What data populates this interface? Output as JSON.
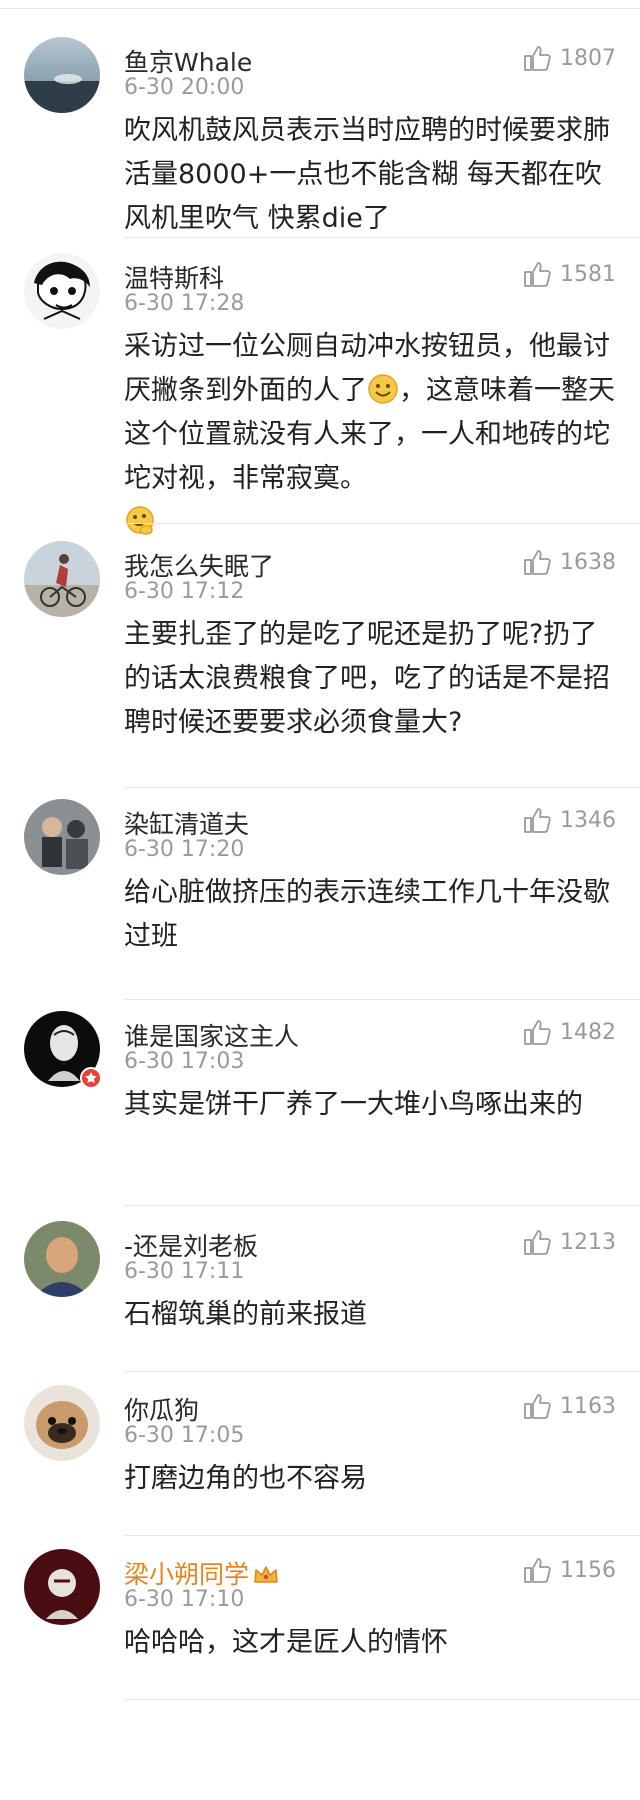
{
  "comments": [
    {
      "name": "鱼京Whale",
      "time": "6-30 20:00",
      "likes": "1807",
      "text": "吹风机鼓风员表示当时应聘的时候要求肺活量8000+一点也不能含糊 每天都在吹风机里吹气 快累die了"
    },
    {
      "name": "温特斯科",
      "time": "6-30 17:28",
      "likes": "1581",
      "text_a": "采访过一位公厕自动冲水按钮员，他最讨厌撇条到外面的人了",
      "text_b": "，这意味着一整天这个位置就没有人来了，一人和地砖的坨坨对视，非常寂寞。"
    },
    {
      "name": "我怎么失眠了",
      "time": "6-30 17:12",
      "likes": "1638",
      "text": "主要扎歪了的是吃了呢还是扔了呢?扔了的话太浪费粮食了吧，吃了的话是不是招聘时候还要要求必须食量大?"
    },
    {
      "name": "染缸清道夫",
      "time": "6-30 17:20",
      "likes": "1346",
      "text": "给心脏做挤压的表示连续工作几十年没歇过班"
    },
    {
      "name": "谁是国家这主人",
      "time": "6-30 17:03",
      "likes": "1482",
      "text": "其实是饼干厂养了一大堆小鸟啄出来的"
    },
    {
      "name": "-还是刘老板",
      "time": "6-30 17:11",
      "likes": "1213",
      "text": "石榴筑巢的前来报道"
    },
    {
      "name": "你瓜狗",
      "time": "6-30 17:05",
      "likes": "1163",
      "text": "打磨边角的也不容易"
    },
    {
      "name": "梁小朔同学",
      "time": "6-30 17:10",
      "likes": "1156",
      "text": "哈哈哈，这才是匠人的情怀"
    }
  ],
  "icons": {
    "like": "thumbs-up-icon",
    "smile": "smile-emoji-icon",
    "think": "thinking-emoji-icon",
    "crown": "crown-icon",
    "badge": "verified-badge-icon"
  },
  "colors": {
    "vip_name": "#e3861f",
    "meta": "#9a9a9a",
    "text": "#222222",
    "divider": "#e6e6e6"
  }
}
